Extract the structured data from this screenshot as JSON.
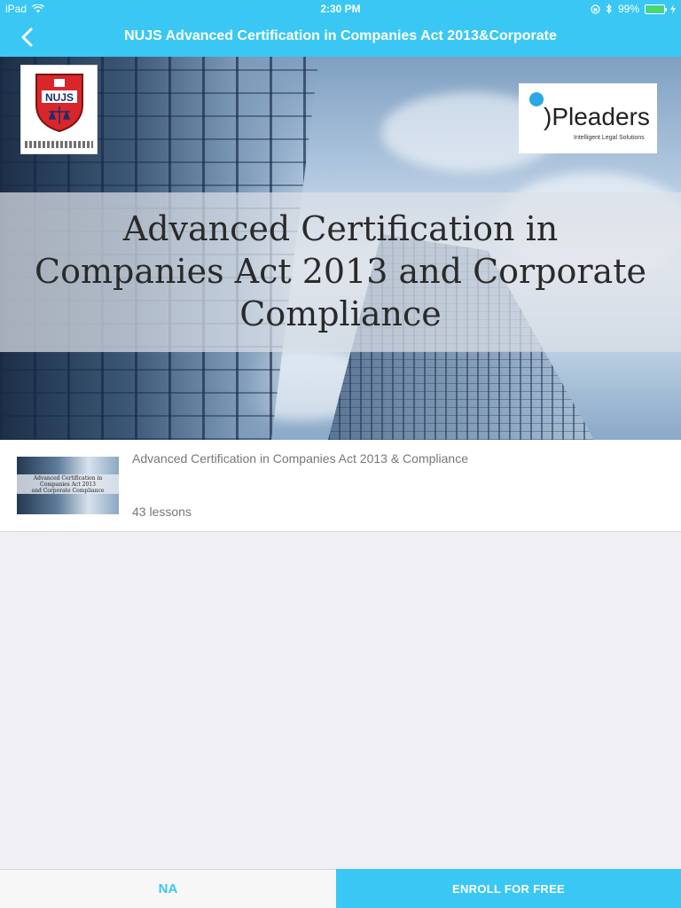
{
  "status_bar": {
    "device": "iPad",
    "time": "2:30 PM",
    "battery_percent": "99%",
    "battery_level": 0.99,
    "icons": [
      "wifi-icon",
      "orientation-lock-icon",
      "bluetooth-icon",
      "battery-icon",
      "charging-icon"
    ]
  },
  "nav": {
    "title": "NUJS Advanced Certification in Companies Act 2013&Corporate",
    "back_icon": "chevron-left-icon"
  },
  "banner": {
    "heading_line1": "Advanced Certification in",
    "heading_line2": "Companies Act 2013 and Corporate",
    "heading_line3": "Compliance",
    "logo_left_text": "NUJS",
    "logo_right_name": ")Pleaders",
    "logo_right_tagline": "Intelligent Legal Solutions"
  },
  "course": {
    "title": "Advanced Certification in Companies Act 2013 & Compliance",
    "lessons": "43 lessons",
    "thumb_line1": "Advanced Certification in",
    "thumb_line2": "Companies Act 2013",
    "thumb_line3": "and Corporate Compliance"
  },
  "bottom": {
    "left_label": "NA",
    "right_label": "ENROLL FOR FREE"
  },
  "colors": {
    "accent": "#3ac7f4",
    "background": "#efeff4",
    "muted_text": "#777777"
  }
}
